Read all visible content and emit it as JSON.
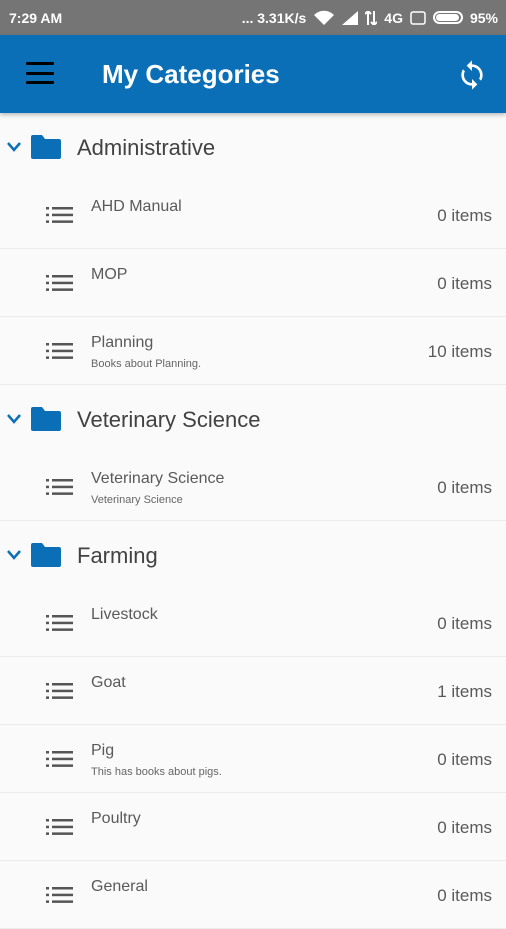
{
  "status_bar": {
    "time": "7:29 AM",
    "net_speed": "... 3.31K/s",
    "network": "4G",
    "battery": "95%"
  },
  "app_bar": {
    "title": "My Categories",
    "menu_icon": "menu-icon",
    "sync_icon": "sync-icon",
    "color": "#0a6fb7"
  },
  "groups": [
    {
      "title": "Administrative",
      "items": [
        {
          "title": "AHD Manual",
          "subtitle": "",
          "count": "0 items"
        },
        {
          "title": "MOP",
          "subtitle": "",
          "count": "0 items"
        },
        {
          "title": "Planning",
          "subtitle": "Books about Planning.",
          "count": "10 items"
        }
      ]
    },
    {
      "title": "Veterinary Science",
      "items": [
        {
          "title": "Veterinary Science",
          "subtitle": "Veterinary Science",
          "count": "0 items"
        }
      ]
    },
    {
      "title": "Farming",
      "items": [
        {
          "title": "Livestock",
          "subtitle": "",
          "count": "0 items"
        },
        {
          "title": "Goat",
          "subtitle": "",
          "count": "1 items"
        },
        {
          "title": "Pig",
          "subtitle": "This has books about pigs.",
          "count": "0 items"
        },
        {
          "title": "Poultry",
          "subtitle": "",
          "count": "0 items"
        },
        {
          "title": "General",
          "subtitle": "",
          "count": "0 items"
        }
      ]
    }
  ]
}
